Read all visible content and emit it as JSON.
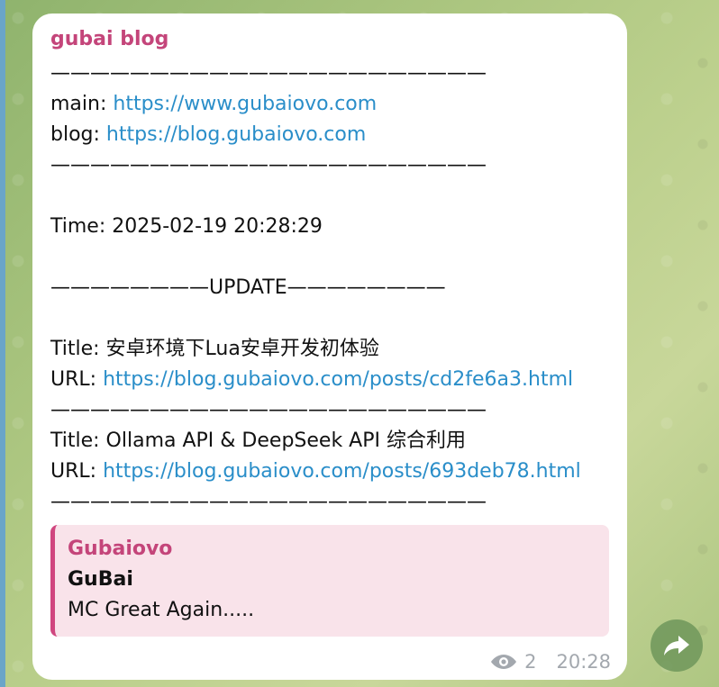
{
  "message": {
    "sender": "gubai blog",
    "lines": [
      {
        "text": "——————————————————————",
        "link": ""
      },
      {
        "label": "main: ",
        "link": "https://www.gubaiovo.com"
      },
      {
        "label": "blog: ",
        "link": "https://blog.gubaiovo.com"
      },
      {
        "text": "——————————————————————",
        "link": ""
      },
      {
        "text": "",
        "link": ""
      },
      {
        "text": "Time: 2025-02-19 20:28:29",
        "link": ""
      },
      {
        "text": "",
        "link": ""
      },
      {
        "text": "————————UPDATE————————",
        "link": ""
      },
      {
        "text": "",
        "link": ""
      },
      {
        "text": "Title: 安卓环境下Lua安卓开发初体验",
        "link": ""
      },
      {
        "label": "URL: ",
        "link": "https://blog.gubaiovo.com/posts/cd2fe6a3.html"
      },
      {
        "text": "——————————————————————",
        "link": ""
      },
      {
        "text": "Title: Ollama API & DeepSeek API 综合利用",
        "link": ""
      },
      {
        "label": "URL: ",
        "link": "https://blog.gubaiovo.com/posts/693deb78.html"
      },
      {
        "text": "——————————————————————",
        "link": ""
      }
    ],
    "quote": {
      "title": "Gubaiovo",
      "heading": "GuBai",
      "text": "MC Great Again....."
    },
    "views": "2",
    "time": "20:28"
  },
  "icons": {
    "views": "eye-icon",
    "share": "share-arrow-icon"
  },
  "colors": {
    "sender": "#c4457a",
    "link": "#2a8ec9",
    "quote_bg": "#f9e3ea",
    "quote_bar": "#d0467f",
    "meta": "#a3a8ae"
  }
}
